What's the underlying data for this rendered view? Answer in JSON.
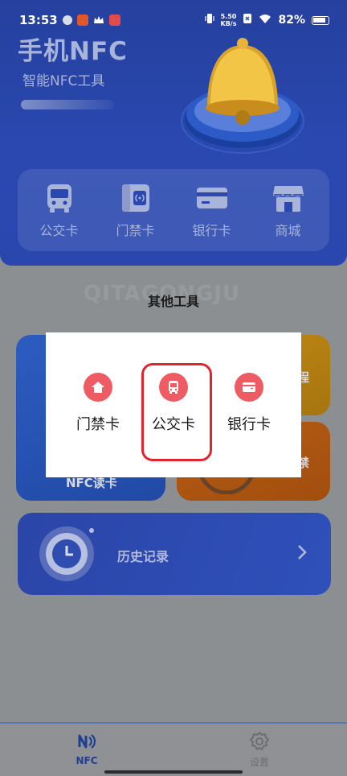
{
  "status_bar": {
    "time": "13:53",
    "net_speed_value": "5.50",
    "net_speed_unit": "KB/s",
    "battery": "82%"
  },
  "header": {
    "title": "手机NFC",
    "subtitle": "智能NFC工具"
  },
  "quick_actions": [
    {
      "label": "公交卡",
      "icon": "bus-icon"
    },
    {
      "label": "门禁卡",
      "icon": "access-card-icon"
    },
    {
      "label": "银行卡",
      "icon": "bank-card-icon"
    },
    {
      "label": "商城",
      "icon": "store-icon"
    }
  ],
  "tools": {
    "watermark": "QITAGONGJU",
    "title": "其他工具",
    "nfc_read_label": "NFC读卡",
    "tile_right_top_partial": "程",
    "tile_right_bottom_partial": "禁"
  },
  "history": {
    "label": "历史记录"
  },
  "bottom_nav": {
    "nfc_label": "NFC",
    "settings_label": "设置"
  },
  "dialog": {
    "options": [
      {
        "label": "门禁卡",
        "icon": "home-icon"
      },
      {
        "label": "公交卡",
        "icon": "bus-icon"
      },
      {
        "label": "银行卡",
        "icon": "bank-card-icon"
      }
    ]
  },
  "colors": {
    "accent_red": "#ee5b62",
    "highlight_red": "#e0262c",
    "hero_blue": "#2a48b0"
  }
}
